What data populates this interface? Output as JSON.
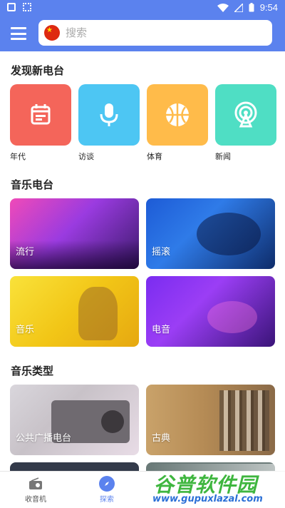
{
  "status_bar": {
    "time": "9:54"
  },
  "header": {
    "search_placeholder": "搜索"
  },
  "sections": {
    "discover_title": "发现新电台",
    "music_title": "音乐电台",
    "genre_title": "音乐类型"
  },
  "discover": [
    {
      "label": "年代",
      "color": "#f4655a",
      "icon": "calendar-icon"
    },
    {
      "label": "访谈",
      "color": "#4dc6f3",
      "icon": "microphone-icon"
    },
    {
      "label": "体育",
      "color": "#ffbb4a",
      "icon": "basketball-icon"
    },
    {
      "label": "新闻",
      "color": "#4fdec4",
      "icon": "broadcast-icon"
    }
  ],
  "music": [
    {
      "label": "流行"
    },
    {
      "label": "摇滚"
    },
    {
      "label": "音乐"
    },
    {
      "label": "电音"
    }
  ],
  "genres": [
    {
      "label": "公共广播电台"
    },
    {
      "label": "古典"
    }
  ],
  "nav": {
    "radio_label": "收音机",
    "explore_label": "探索"
  },
  "watermark": {
    "title": "谷普软件园",
    "url": "www.gupuxlazal.com"
  },
  "colors": {
    "primary": "#5b82ee"
  }
}
